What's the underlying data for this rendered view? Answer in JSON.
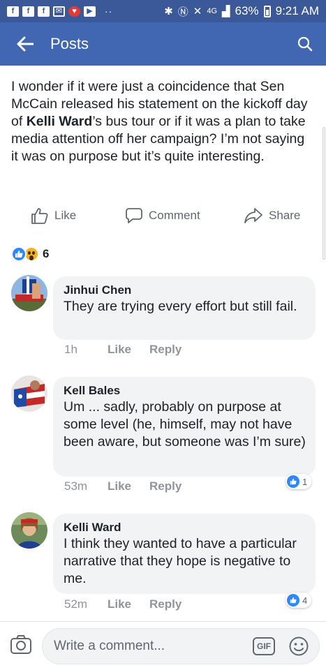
{
  "status_bar": {
    "signal": "4G",
    "battery": "63%",
    "time": "9:21 AM"
  },
  "header": {
    "title": "Posts"
  },
  "post": {
    "text_before": "I wonder if it were just a coincidence that Sen McCain released his statement on the kickoff day of ",
    "text_bold": "Kelli Ward",
    "text_after": "’s bus tour or if it was a plan to take media attention off her campaign? I’m not saying it was on purpose but it’s quite interesting.",
    "actions": {
      "like": "Like",
      "comment": "Comment",
      "share": "Share"
    },
    "reactions": {
      "types": [
        "like",
        "wow"
      ],
      "count": "6"
    }
  },
  "comments": [
    {
      "author": "Jinhui Chen",
      "text": "They are trying every effort but still fail.",
      "time": "1h",
      "like_label": "Like",
      "reply_label": "Reply",
      "reaction_count": null
    },
    {
      "author": "Kell Bales",
      "text": "Um ... sadly, probably on purpose at some level (he, himself, may not have been aware, but someone was I’m sure)",
      "time": "53m",
      "like_label": "Like",
      "reply_label": "Reply",
      "reaction_count": "1"
    },
    {
      "author": "Kelli Ward",
      "text": "I think they wanted to have a particular narrative that they hope is negative to me.",
      "time": "52m",
      "like_label": "Like",
      "reply_label": "Reply",
      "reaction_count": "4"
    }
  ],
  "composer": {
    "placeholder": "Write a comment...",
    "gif_label": "GIF"
  },
  "colors": {
    "brand_blue": "#4267b2",
    "status_blue": "#3b5998",
    "like_blue": "#2d88ff"
  }
}
